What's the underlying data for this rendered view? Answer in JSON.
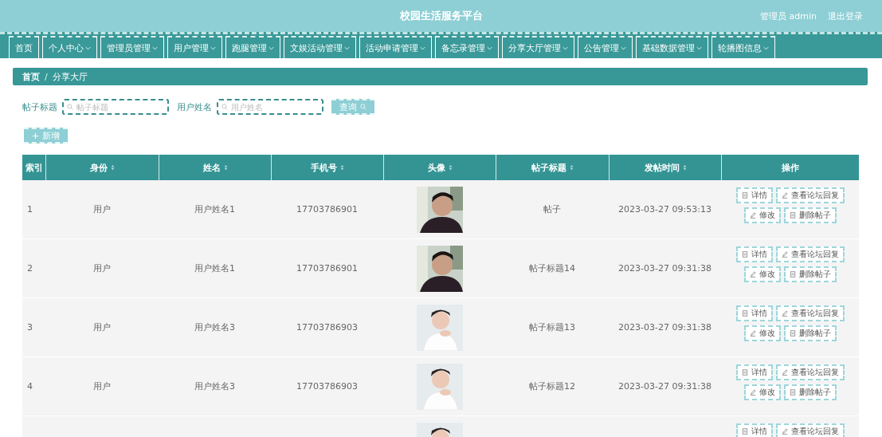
{
  "header": {
    "title": "校园生活服务平台",
    "user": "管理员 admin",
    "logout": "退出登录"
  },
  "nav": [
    {
      "label": "首页",
      "dropdown": false
    },
    {
      "label": "个人中心",
      "dropdown": true
    },
    {
      "label": "管理员管理",
      "dropdown": true
    },
    {
      "label": "用户管理",
      "dropdown": true
    },
    {
      "label": "跑腿管理",
      "dropdown": true
    },
    {
      "label": "文娱活动管理",
      "dropdown": true
    },
    {
      "label": "活动申请管理",
      "dropdown": true
    },
    {
      "label": "备忘录管理",
      "dropdown": true
    },
    {
      "label": "分享大厅管理",
      "dropdown": true
    },
    {
      "label": "公告管理",
      "dropdown": true
    },
    {
      "label": "基础数据管理",
      "dropdown": true
    },
    {
      "label": "轮播图信息",
      "dropdown": true
    }
  ],
  "breadcrumb": [
    "首页",
    "分享大厅"
  ],
  "breadcrumb_separator": "/",
  "search": {
    "fields": [
      {
        "label": "帖子标题",
        "placeholder": "帖子标题"
      },
      {
        "label": "用户姓名",
        "placeholder": "用户姓名"
      }
    ],
    "button": "查询"
  },
  "add_button": "新增",
  "table": {
    "columns": [
      {
        "label": "索引",
        "sortable": false
      },
      {
        "label": "身份",
        "sortable": true
      },
      {
        "label": "姓名",
        "sortable": true
      },
      {
        "label": "手机号",
        "sortable": true
      },
      {
        "label": "头像",
        "sortable": true
      },
      {
        "label": "帖子标题",
        "sortable": true
      },
      {
        "label": "发帖时间",
        "sortable": true
      },
      {
        "label": "操作",
        "sortable": false
      }
    ],
    "rows": [
      {
        "index": "1",
        "role": "用户",
        "name": "用户姓名1",
        "phone": "17703786901",
        "avatar": {
          "kind": "picture"
        },
        "title": "帖子",
        "time": "2023-03-27 09:53:13",
        "actions": [
          {
            "kind": "detail",
            "label": "详情"
          },
          {
            "kind": "reply",
            "label": "查看论坛回复"
          },
          {
            "kind": "edit",
            "label": "修改"
          },
          {
            "kind": "delete",
            "label": "删除帖子"
          }
        ]
      },
      {
        "index": "2",
        "role": "用户",
        "name": "用户姓名1",
        "phone": "17703786901",
        "avatar": {
          "kind": "picture"
        },
        "title": "帖子标题14",
        "time": "2023-03-27 09:31:38",
        "actions": [
          {
            "kind": "detail",
            "label": "详情"
          },
          {
            "kind": "reply",
            "label": "查看论坛回复"
          },
          {
            "kind": "edit",
            "label": "修改"
          },
          {
            "kind": "delete",
            "label": "删除帖子"
          }
        ]
      },
      {
        "index": "3",
        "role": "用户",
        "name": "用户姓名3",
        "phone": "17703786903",
        "avatar": {
          "kind": "picture"
        },
        "title": "帖子标题13",
        "time": "2023-03-27 09:31:38",
        "actions": [
          {
            "kind": "detail",
            "label": "详情"
          },
          {
            "kind": "reply",
            "label": "查看论坛回复"
          },
          {
            "kind": "edit",
            "label": "修改"
          },
          {
            "kind": "delete",
            "label": "删除帖子"
          }
        ]
      },
      {
        "index": "4",
        "role": "用户",
        "name": "用户姓名3",
        "phone": "17703786903",
        "avatar": {
          "kind": "picture"
        },
        "title": "帖子标题12",
        "time": "2023-03-27 09:31:38",
        "actions": [
          {
            "kind": "detail",
            "label": "详情"
          },
          {
            "kind": "reply",
            "label": "查看论坛回复"
          },
          {
            "kind": "edit",
            "label": "修改"
          },
          {
            "kind": "delete",
            "label": "删除帖子"
          }
        ]
      },
      {
        "avatar": {
          "kind": "picture"
        },
        "actions": [
          {
            "kind": "detail",
            "label": "详情"
          },
          {
            "kind": "reply",
            "label": "查看论坛回复"
          }
        ]
      }
    ]
  }
}
